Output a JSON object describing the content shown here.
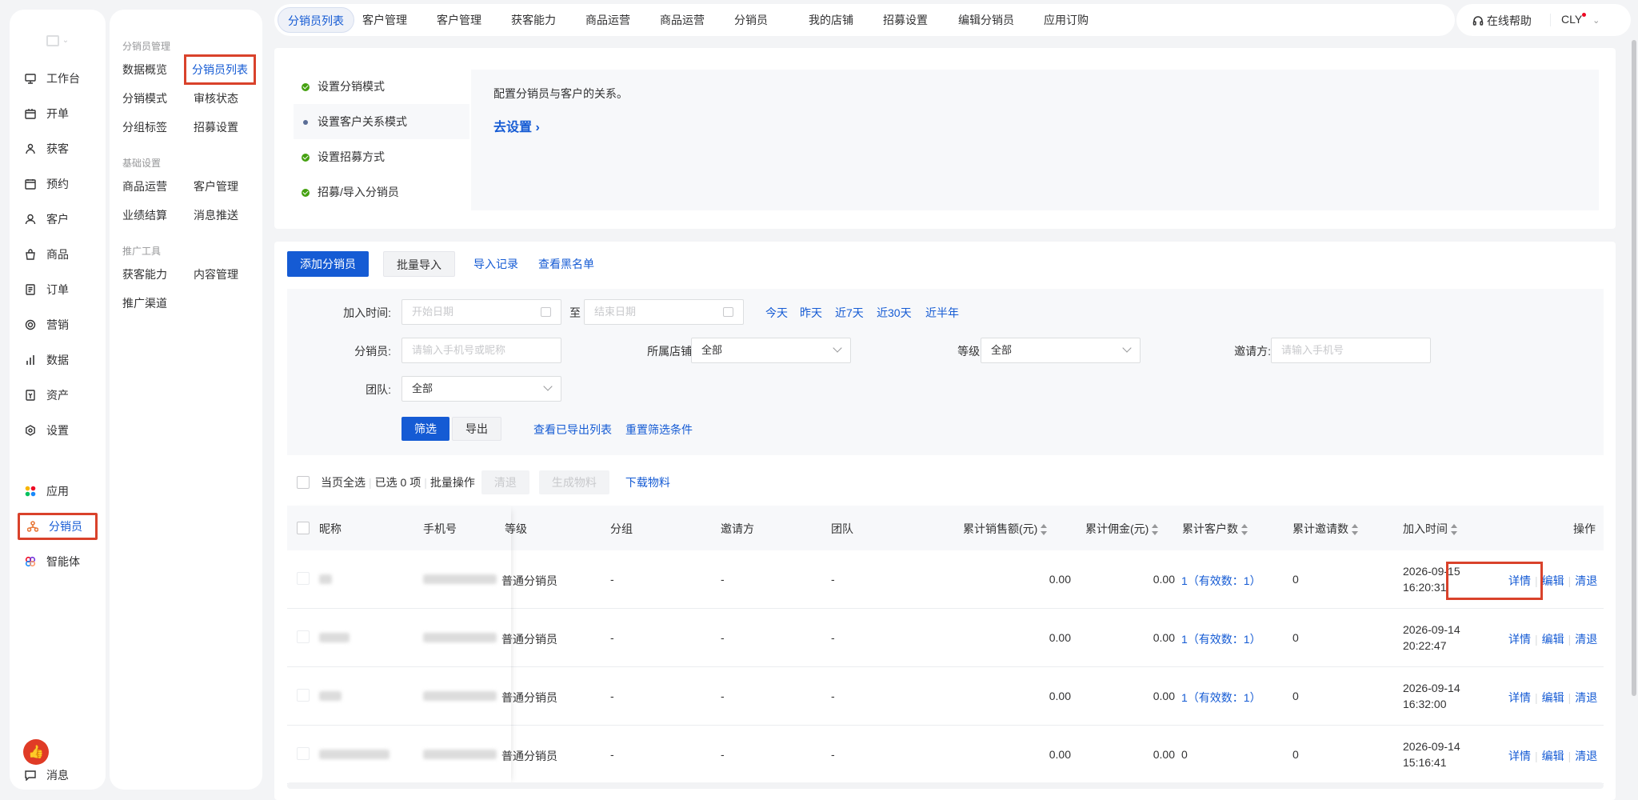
{
  "sidebar": {
    "items": [
      {
        "label": "工作台",
        "icon": "workbench-icon"
      },
      {
        "label": "开单",
        "icon": "order-open-icon"
      },
      {
        "label": "获客",
        "icon": "acquire-icon"
      },
      {
        "label": "预约",
        "icon": "calendar-icon"
      },
      {
        "label": "客户",
        "icon": "user-icon"
      },
      {
        "label": "商品",
        "icon": "bag-icon"
      },
      {
        "label": "订单",
        "icon": "list-icon"
      },
      {
        "label": "营销",
        "icon": "target-icon"
      },
      {
        "label": "数据",
        "icon": "chart-icon"
      },
      {
        "label": "资产",
        "icon": "asset-icon"
      },
      {
        "label": "设置",
        "icon": "gear-icon"
      },
      {
        "label": "应用",
        "icon": "apps-icon"
      },
      {
        "label": "分销员",
        "icon": "distributor-icon"
      },
      {
        "label": "智能体",
        "icon": "agent-icon"
      }
    ],
    "message_label": "消息"
  },
  "submenu": {
    "group1": "分销员管理",
    "g1_items": [
      "数据概览",
      "分销员列表",
      "分销模式",
      "审核状态",
      "分组标签",
      "招募设置"
    ],
    "group2": "基础设置",
    "g2_items": [
      "商品运营",
      "客户管理",
      "业绩结算",
      "消息推送"
    ],
    "group3": "推广工具",
    "g3_items": [
      "获客能力",
      "内容管理",
      "推广渠道"
    ]
  },
  "tabs": [
    "分销员列表",
    "客户管理",
    "客户管理",
    "获客能力",
    "商品运营",
    "商品运营",
    "分销员",
    "我的店铺",
    "招募设置",
    "编辑分销员",
    "应用订购"
  ],
  "header": {
    "help": "在线帮助",
    "user": "CLY"
  },
  "guide": {
    "steps": [
      "设置分销模式",
      "设置客户关系模式",
      "设置招募方式",
      "招募/导入分销员"
    ],
    "description": "配置分销员与客户的关系。",
    "action": "去设置 ›"
  },
  "toolbar": {
    "add": "添加分销员",
    "import": "批量导入",
    "import_log": "导入记录",
    "blacklist": "查看黑名单"
  },
  "filter": {
    "join_time_label": "加入时间:",
    "start_placeholder": "开始日期",
    "to": "至",
    "end_placeholder": "结束日期",
    "quick": [
      "今天",
      "昨天",
      "近7天",
      "近30天",
      "近半年"
    ],
    "distributor_label": "分销员:",
    "distributor_placeholder": "请输入手机号或昵称",
    "store_label": "所属店铺:",
    "store_value": "全部",
    "level_label": "等级:",
    "level_value": "全部",
    "inviter_label": "邀请方:",
    "inviter_placeholder": "请输入手机号",
    "team_label": "团队:",
    "team_value": "全部",
    "filter_btn": "筛选",
    "export_btn": "导出",
    "view_exported": "查看已导出列表",
    "reset": "重置筛选条件"
  },
  "bulk": {
    "select_page": "当页全选",
    "selected": "已选 0 项",
    "batch": "批量操作",
    "retreat": "清退",
    "generate": "生成物料",
    "download": "下载物料"
  },
  "table": {
    "columns": [
      "昵称",
      "手机号",
      "等级",
      "分组",
      "邀请方",
      "团队",
      "累计销售额(元)",
      "累计佣金(元)",
      "累计客户数",
      "累计邀请数",
      "加入时间",
      "操作"
    ],
    "rows": [
      {
        "level": "普通分销员",
        "group": "-",
        "inviter": "-",
        "team": "-",
        "sales": "0.00",
        "commission": "0.00",
        "customers": "1（有效数：1）",
        "invites": "0",
        "date": "2026-09-15",
        "time": "16:20:31"
      },
      {
        "level": "普通分销员",
        "group": "-",
        "inviter": "-",
        "team": "-",
        "sales": "0.00",
        "commission": "0.00",
        "customers": "1（有效数：1）",
        "invites": "0",
        "date": "2026-09-14",
        "time": "20:22:47"
      },
      {
        "level": "普通分销员",
        "group": "-",
        "inviter": "-",
        "team": "-",
        "sales": "0.00",
        "commission": "0.00",
        "customers": "1（有效数：1）",
        "invites": "0",
        "date": "2026-09-14",
        "time": "16:32:00"
      },
      {
        "level": "普通分销员",
        "group": "-",
        "inviter": "-",
        "team": "-",
        "sales": "0.00",
        "commission": "0.00",
        "customers": "0",
        "invites": "0",
        "date": "2026-09-14",
        "time": "15:16:41"
      }
    ],
    "ops": [
      "详情",
      "编辑",
      "清退"
    ]
  },
  "colors": {
    "primary": "#155bd4",
    "highlight": "#d9422b",
    "success": "#45a110"
  }
}
